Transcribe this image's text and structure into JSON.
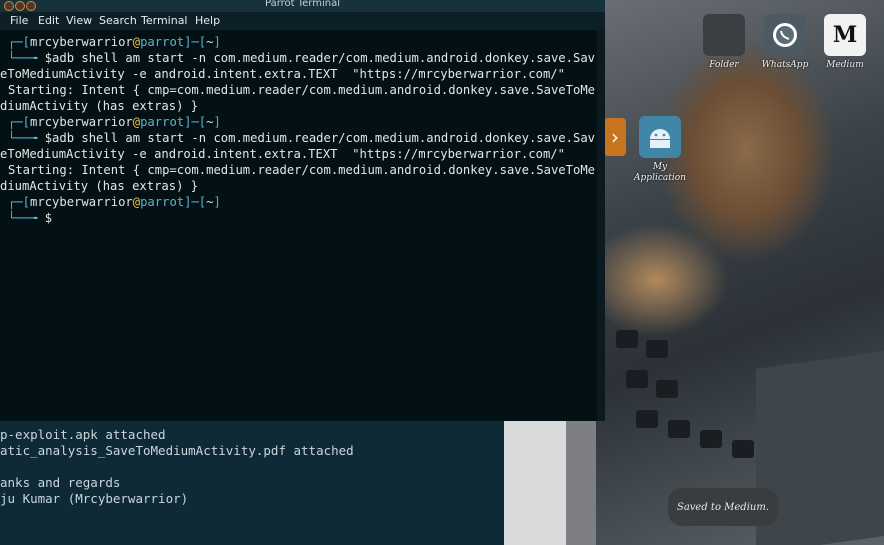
{
  "window": {
    "title": "Parrot Terminal",
    "menu": [
      "File",
      "Edit",
      "View",
      "Search",
      "Terminal",
      "Help"
    ]
  },
  "terminal": {
    "lines": [
      {
        "kind": "prompt",
        "user": "mrcyberwarrior",
        "host": "parrot",
        "path": "~"
      },
      {
        "kind": "cmd",
        "text": "$adb shell am start -n com.medium.reader/com.medium.android.donkey.save.Sav"
      },
      {
        "kind": "out",
        "text": "eToMediumActivity -e android.intent.extra.TEXT  \"https://mrcyberwarrior.com/\""
      },
      {
        "kind": "out",
        "text": "Starting: Intent { cmp=com.medium.reader/com.medium.android.donkey.save.SaveToMe"
      },
      {
        "kind": "out",
        "text": "diumActivity (has extras) }"
      },
      {
        "kind": "prompt",
        "user": "mrcyberwarrior",
        "host": "parrot",
        "path": "~"
      },
      {
        "kind": "cmd",
        "text": "$adb shell am start -n com.medium.reader/com.medium.android.donkey.save.Sav"
      },
      {
        "kind": "out",
        "text": "eToMediumActivity -e android.intent.extra.TEXT  \"https://mrcyberwarrior.com/\""
      },
      {
        "kind": "out",
        "text": "Starting: Intent { cmp=com.medium.reader/com.medium.android.donkey.save.SaveToMe"
      },
      {
        "kind": "out",
        "text": "diumActivity (has extras) }"
      },
      {
        "kind": "prompt",
        "user": "mrcyberwarrior",
        "host": "parrot",
        "path": "~"
      },
      {
        "kind": "cmd",
        "text": "$"
      }
    ]
  },
  "background_terminal": {
    "lines": [
      "p-exploit.apk attached",
      "atic_analysis_SaveToMediumActivity.pdf attached",
      "",
      "anks and regards",
      "ju Kumar (Mrcyberwarrior)"
    ]
  },
  "phone": {
    "apps": [
      {
        "label": "Folder"
      },
      {
        "label": "WhatsApp"
      },
      {
        "label": "Medium"
      },
      {
        "label": "My Application"
      }
    ],
    "toast": "Saved to Medium."
  }
}
